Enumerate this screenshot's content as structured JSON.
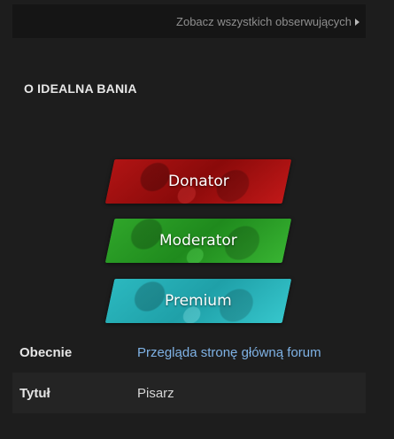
{
  "followers": {
    "link_label": "Zobacz wszystkich obserwujących"
  },
  "about": {
    "title": "O IDEALNA BANIA"
  },
  "badges": [
    {
      "label": "Donator",
      "color": "#b01414"
    },
    {
      "label": "Moderator",
      "color": "#2fa52a"
    },
    {
      "label": "Premium",
      "color": "#2bb8bf"
    }
  ],
  "info": {
    "currently": {
      "label": "Obecnie",
      "value": "Przegląda stronę główną forum"
    },
    "title": {
      "label": "Tytuł",
      "value": "Pisarz"
    }
  }
}
